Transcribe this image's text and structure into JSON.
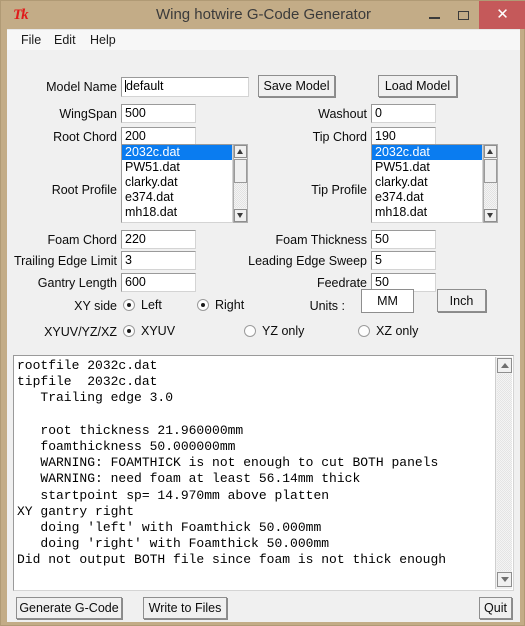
{
  "window": {
    "title": "Wing hotwire G-Code Generator",
    "icon": "tk-icon",
    "app_icon_text": "Tk",
    "accent_close": "#c5595a",
    "frame_color": "#c3ac87",
    "minimize_label": "–",
    "maximize_label": "□",
    "close_label": "✕"
  },
  "menubar": {
    "items": [
      {
        "label": "File"
      },
      {
        "label": "Edit"
      },
      {
        "label": "Help"
      }
    ]
  },
  "form": {
    "model_name": {
      "label": "Model Name",
      "value": "default"
    },
    "wingspan": {
      "label": "WingSpan",
      "value": "500"
    },
    "root_chord": {
      "label": "Root Chord",
      "value": "200"
    },
    "root_profile": {
      "label": "Root Profile"
    },
    "foam_chord": {
      "label": "Foam Chord",
      "value": "220"
    },
    "trailing_edge_limit": {
      "label": "Trailing Edge Limit",
      "value": "3"
    },
    "gantry_length": {
      "label": "Gantry Length",
      "value": "600"
    },
    "washout": {
      "label": "Washout",
      "value": "0"
    },
    "tip_chord": {
      "label": "Tip Chord",
      "value": "190"
    },
    "tip_profile": {
      "label": "Tip Profile"
    },
    "foam_thickness": {
      "label": "Foam Thickness",
      "value": "50"
    },
    "leading_edge_sweep": {
      "label": "Leading Edge Sweep",
      "value": "5"
    },
    "feedrate": {
      "label": "Feedrate",
      "value": "50"
    },
    "save_model": {
      "label": "Save Model"
    },
    "load_model": {
      "label": "Load Model"
    },
    "units": {
      "label": "Units :",
      "mm_label": "MM",
      "inch_label": "Inch",
      "selected": "MM"
    },
    "xy_side": {
      "label": "XY side",
      "options": [
        {
          "label": "Left",
          "selected": false
        },
        {
          "label": "Right",
          "selected": true
        }
      ]
    },
    "axis_mode": {
      "label": "XYUV/YZ/XZ",
      "options": [
        {
          "label": "XYUV",
          "selected": true
        },
        {
          "label": "YZ only",
          "selected": false
        },
        {
          "label": "XZ only",
          "selected": false
        }
      ]
    }
  },
  "profile_list": {
    "items": [
      "2032c.dat",
      "PW51.dat",
      "clarky.dat",
      "e374.dat",
      "mh18.dat"
    ],
    "selected_index": 0,
    "scroll_up_icon": "triangle-up-icon",
    "scroll_down_icon": "triangle-down-icon"
  },
  "console": {
    "text": "rootfile 2032c.dat\ntipfile  2032c.dat\n   Trailing edge 3.0\n\n   root thickness 21.960000mm\n   foamthickness 50.000000mm\n   WARNING: FOAMTHICK is not enough to cut BOTH panels\n   WARNING: need foam at least 56.14mm thick\n   startpoint sp= 14.970mm above platten\nXY gantry right\n   doing 'left' with Foamthick 50.000mm\n   doing 'right' with Foamthick 50.000mm\nDid not output BOTH file since foam is not thick enough",
    "scroll_up_icon": "triangle-up-icon",
    "scroll_down_icon": "triangle-down-icon"
  },
  "bottombar": {
    "generate": {
      "label": "Generate G-Code"
    },
    "write": {
      "label": "Write to Files"
    },
    "quit": {
      "label": "Quit"
    }
  }
}
